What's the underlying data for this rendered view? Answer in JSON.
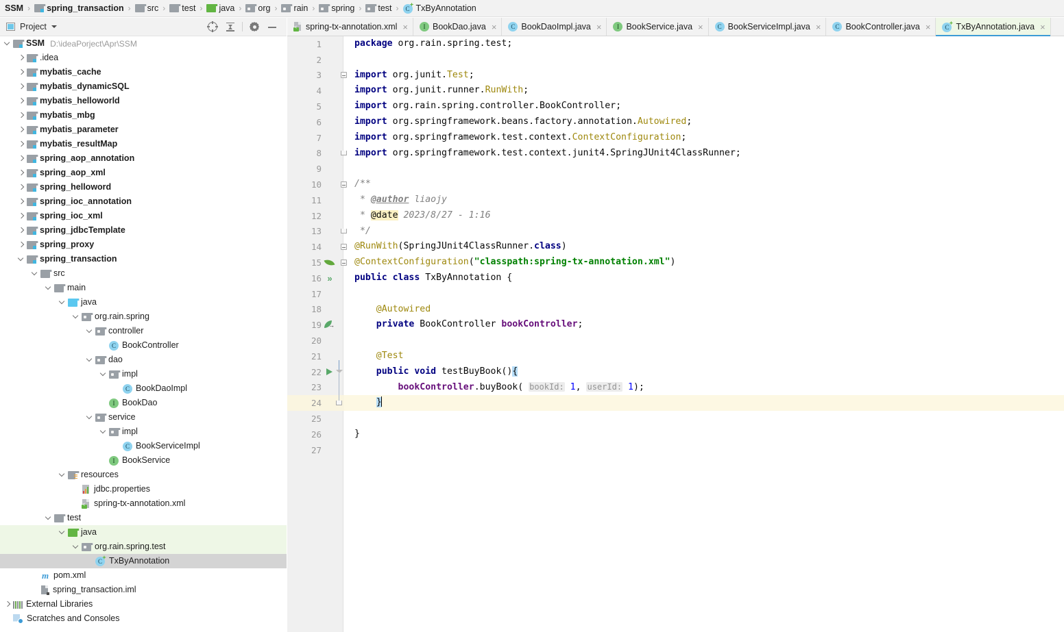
{
  "breadcrumb": {
    "items": [
      {
        "label": "SSM",
        "icon": "none",
        "bold": true
      },
      {
        "label": "spring_transaction",
        "icon": "module-folder-icon",
        "bold": true
      },
      {
        "label": "src",
        "icon": "folder-icon",
        "bold": false
      },
      {
        "label": "test",
        "icon": "folder-icon",
        "bold": false
      },
      {
        "label": "java",
        "icon": "green-folder-icon",
        "bold": false
      },
      {
        "label": "org",
        "icon": "package-icon",
        "bold": false
      },
      {
        "label": "rain",
        "icon": "package-icon",
        "bold": false
      },
      {
        "label": "spring",
        "icon": "package-icon",
        "bold": false
      },
      {
        "label": "test",
        "icon": "package-icon",
        "bold": false
      },
      {
        "label": "TxByAnnotation",
        "icon": "test-class-icon",
        "bold": false
      }
    ],
    "separator": "›"
  },
  "tool_window": {
    "title": "Project",
    "dropdown_icon": "chevron-down-icon",
    "window_icon": "project-window-icon",
    "actions": [
      {
        "name": "locate-icon",
        "tooltip": "Select Opened File"
      },
      {
        "name": "collapse-all-icon",
        "tooltip": "Collapse All"
      },
      {
        "name": "gear-icon",
        "tooltip": "Settings"
      },
      {
        "name": "minimize-icon",
        "tooltip": "Hide"
      }
    ]
  },
  "tree": {
    "rows": [
      {
        "indent": 0,
        "expander": "down",
        "icon": "module-folder-icon",
        "label": "SSM",
        "bold": true,
        "path": "D:\\ideaPorject\\Apr\\SSM",
        "state": "normal"
      },
      {
        "indent": 1,
        "expander": "right",
        "icon": "module-folder-icon",
        "label": ".idea",
        "bold": false,
        "state": "normal"
      },
      {
        "indent": 1,
        "expander": "right",
        "icon": "module-folder-icon",
        "label": "mybatis_cache",
        "bold": true,
        "state": "normal"
      },
      {
        "indent": 1,
        "expander": "right",
        "icon": "module-folder-icon",
        "label": "mybatis_dynamicSQL",
        "bold": true,
        "state": "normal"
      },
      {
        "indent": 1,
        "expander": "right",
        "icon": "module-folder-icon",
        "label": "mybatis_helloworld",
        "bold": true,
        "state": "normal"
      },
      {
        "indent": 1,
        "expander": "right",
        "icon": "module-folder-icon",
        "label": "mybatis_mbg",
        "bold": true,
        "state": "normal"
      },
      {
        "indent": 1,
        "expander": "right",
        "icon": "module-folder-icon",
        "label": "mybatis_parameter",
        "bold": true,
        "state": "normal"
      },
      {
        "indent": 1,
        "expander": "right",
        "icon": "module-folder-icon",
        "label": "mybatis_resultMap",
        "bold": true,
        "state": "normal"
      },
      {
        "indent": 1,
        "expander": "right",
        "icon": "module-folder-icon",
        "label": "spring_aop_annotation",
        "bold": true,
        "state": "normal"
      },
      {
        "indent": 1,
        "expander": "right",
        "icon": "module-folder-icon",
        "label": "spring_aop_xml",
        "bold": true,
        "state": "normal"
      },
      {
        "indent": 1,
        "expander": "right",
        "icon": "module-folder-icon",
        "label": "spring_helloword",
        "bold": true,
        "state": "normal"
      },
      {
        "indent": 1,
        "expander": "right",
        "icon": "module-folder-icon",
        "label": "spring_ioc_annotation",
        "bold": true,
        "state": "normal"
      },
      {
        "indent": 1,
        "expander": "right",
        "icon": "module-folder-icon",
        "label": "spring_ioc_xml",
        "bold": true,
        "state": "normal"
      },
      {
        "indent": 1,
        "expander": "right",
        "icon": "module-folder-icon",
        "label": "spring_jdbcTemplate",
        "bold": true,
        "state": "normal"
      },
      {
        "indent": 1,
        "expander": "right",
        "icon": "module-folder-icon",
        "label": "spring_proxy",
        "bold": true,
        "state": "normal"
      },
      {
        "indent": 1,
        "expander": "down",
        "icon": "module-folder-icon",
        "label": "spring_transaction",
        "bold": true,
        "state": "normal"
      },
      {
        "indent": 2,
        "expander": "down",
        "icon": "folder-icon",
        "label": "src",
        "bold": false,
        "state": "normal"
      },
      {
        "indent": 3,
        "expander": "down",
        "icon": "folder-icon",
        "label": "main",
        "bold": false,
        "state": "normal"
      },
      {
        "indent": 4,
        "expander": "down",
        "icon": "blue-folder-icon",
        "label": "java",
        "bold": false,
        "state": "normal"
      },
      {
        "indent": 5,
        "expander": "down",
        "icon": "package-icon",
        "label": "org.rain.spring",
        "bold": false,
        "state": "normal"
      },
      {
        "indent": 6,
        "expander": "down",
        "icon": "package-icon",
        "label": "controller",
        "bold": false,
        "state": "normal"
      },
      {
        "indent": 7,
        "expander": "none",
        "icon": "class-icon",
        "label": "BookController",
        "bold": false,
        "state": "normal"
      },
      {
        "indent": 6,
        "expander": "down",
        "icon": "package-icon",
        "label": "dao",
        "bold": false,
        "state": "normal"
      },
      {
        "indent": 7,
        "expander": "down",
        "icon": "package-icon",
        "label": "impl",
        "bold": false,
        "state": "normal"
      },
      {
        "indent": 8,
        "expander": "none",
        "icon": "class-icon",
        "label": "BookDaoImpl",
        "bold": false,
        "state": "normal"
      },
      {
        "indent": 7,
        "expander": "none",
        "icon": "interface-icon",
        "label": "BookDao",
        "bold": false,
        "state": "normal"
      },
      {
        "indent": 6,
        "expander": "down",
        "icon": "package-icon",
        "label": "service",
        "bold": false,
        "state": "normal"
      },
      {
        "indent": 7,
        "expander": "down",
        "icon": "package-icon",
        "label": "impl",
        "bold": false,
        "state": "normal"
      },
      {
        "indent": 8,
        "expander": "none",
        "icon": "class-icon",
        "label": "BookServiceImpl",
        "bold": false,
        "state": "normal"
      },
      {
        "indent": 7,
        "expander": "none",
        "icon": "interface-icon",
        "label": "BookService",
        "bold": false,
        "state": "normal"
      },
      {
        "indent": 4,
        "expander": "down",
        "icon": "resources-folder-icon",
        "label": "resources",
        "bold": false,
        "state": "normal"
      },
      {
        "indent": 5,
        "expander": "none",
        "icon": "properties-file-icon",
        "label": "jdbc.properties",
        "bold": false,
        "state": "normal"
      },
      {
        "indent": 5,
        "expander": "none",
        "icon": "xml-file-icon",
        "label": "spring-tx-annotation.xml",
        "bold": false,
        "state": "normal"
      },
      {
        "indent": 3,
        "expander": "down",
        "icon": "folder-icon",
        "label": "test",
        "bold": false,
        "state": "normal"
      },
      {
        "indent": 4,
        "expander": "down",
        "icon": "green-folder-icon",
        "label": "java",
        "bold": false,
        "state": "test-root"
      },
      {
        "indent": 5,
        "expander": "down",
        "icon": "package-icon",
        "label": "org.rain.spring.test",
        "bold": false,
        "state": "test-root"
      },
      {
        "indent": 6,
        "expander": "none",
        "icon": "test-class-icon",
        "label": "TxByAnnotation",
        "bold": false,
        "state": "selected"
      },
      {
        "indent": 2,
        "expander": "none",
        "icon": "maven-icon",
        "label": "pom.xml",
        "bold": false,
        "state": "normal"
      },
      {
        "indent": 2,
        "expander": "none",
        "icon": "iml-file-icon",
        "label": "spring_transaction.iml",
        "bold": false,
        "state": "normal"
      },
      {
        "indent": 0,
        "expander": "right",
        "icon": "external-libraries-icon",
        "label": "External Libraries",
        "bold": false,
        "state": "normal"
      },
      {
        "indent": 0,
        "expander": "none",
        "icon": "scratches-icon",
        "label": "Scratches and Consoles",
        "bold": false,
        "state": "normal"
      }
    ]
  },
  "editor_tabs": {
    "close_glyph": "×",
    "items": [
      {
        "label": "spring-tx-annotation.xml",
        "icon": "xml-file-icon",
        "active": false
      },
      {
        "label": "BookDao.java",
        "icon": "interface-icon",
        "active": false
      },
      {
        "label": "BookDaoImpl.java",
        "icon": "class-icon",
        "active": false
      },
      {
        "label": "BookService.java",
        "icon": "interface-icon",
        "active": false
      },
      {
        "label": "BookServiceImpl.java",
        "icon": "class-icon",
        "active": false
      },
      {
        "label": "BookController.java",
        "icon": "class-icon",
        "active": false
      },
      {
        "label": "TxByAnnotation.java",
        "icon": "test-class-icon",
        "active": true
      }
    ]
  },
  "editor": {
    "filename": "TxByAnnotation.java",
    "caret_line": 24,
    "total_lines": 27,
    "lines": [
      {
        "n": 1,
        "gutter": "none",
        "fold": "none",
        "tokens": [
          {
            "t": "package ",
            "c": "kw"
          },
          {
            "t": "org.rain.spring.test;",
            "c": "plain"
          }
        ]
      },
      {
        "n": 2,
        "gutter": "none",
        "fold": "none",
        "tokens": []
      },
      {
        "n": 3,
        "gutter": "none",
        "fold": "fold-open",
        "tokens": [
          {
            "t": "import ",
            "c": "kw"
          },
          {
            "t": "org.junit.",
            "c": "plain"
          },
          {
            "t": "Test",
            "c": "ann"
          },
          {
            "t": ";",
            "c": "plain"
          }
        ]
      },
      {
        "n": 4,
        "gutter": "none",
        "fold": "none",
        "tokens": [
          {
            "t": "import ",
            "c": "kw"
          },
          {
            "t": "org.junit.runner.",
            "c": "plain"
          },
          {
            "t": "RunWith",
            "c": "ann"
          },
          {
            "t": ";",
            "c": "plain"
          }
        ]
      },
      {
        "n": 5,
        "gutter": "none",
        "fold": "none",
        "tokens": [
          {
            "t": "import ",
            "c": "kw"
          },
          {
            "t": "org.rain.spring.controller.BookController;",
            "c": "plain"
          }
        ]
      },
      {
        "n": 6,
        "gutter": "none",
        "fold": "none",
        "tokens": [
          {
            "t": "import ",
            "c": "kw"
          },
          {
            "t": "org.springframework.beans.factory.annotation.",
            "c": "plain"
          },
          {
            "t": "Autowired",
            "c": "ann"
          },
          {
            "t": ";",
            "c": "plain"
          }
        ]
      },
      {
        "n": 7,
        "gutter": "none",
        "fold": "none",
        "tokens": [
          {
            "t": "import ",
            "c": "kw"
          },
          {
            "t": "org.springframework.test.context.",
            "c": "plain"
          },
          {
            "t": "ContextConfiguration",
            "c": "ann"
          },
          {
            "t": ";",
            "c": "plain"
          }
        ]
      },
      {
        "n": 8,
        "gutter": "none",
        "fold": "fold-end",
        "tokens": [
          {
            "t": "import ",
            "c": "kw"
          },
          {
            "t": "org.springframework.test.context.junit4.SpringJUnit4ClassRunner;",
            "c": "plain"
          }
        ]
      },
      {
        "n": 9,
        "gutter": "none",
        "fold": "none",
        "tokens": []
      },
      {
        "n": 10,
        "gutter": "none",
        "fold": "fold-open",
        "tokens": [
          {
            "t": "/**",
            "c": "cmt"
          }
        ]
      },
      {
        "n": 11,
        "gutter": "none",
        "fold": "none",
        "tokens": [
          {
            "t": " * ",
            "c": "cmt"
          },
          {
            "t": "@author",
            "c": "cmt-tag"
          },
          {
            "t": " liaojy",
            "c": "cmt"
          }
        ]
      },
      {
        "n": 12,
        "gutter": "none",
        "fold": "none",
        "tokens": [
          {
            "t": " * ",
            "c": "cmt"
          },
          {
            "t": "@date",
            "c": "cmt-tag-hl"
          },
          {
            "t": " 2023/8/27 - 1:16",
            "c": "cmt"
          }
        ]
      },
      {
        "n": 13,
        "gutter": "none",
        "fold": "fold-end",
        "tokens": [
          {
            "t": " */",
            "c": "cmt"
          }
        ]
      },
      {
        "n": 14,
        "gutter": "none",
        "fold": "fold-open",
        "tokens": [
          {
            "t": "@RunWith",
            "c": "ann"
          },
          {
            "t": "(SpringJUnit4ClassRunner.",
            "c": "plain"
          },
          {
            "t": "class",
            "c": "kw"
          },
          {
            "t": ")",
            "c": "plain"
          }
        ]
      },
      {
        "n": 15,
        "gutter": "spring-bean-icon",
        "fold": "fold-open",
        "tokens": [
          {
            "t": "@ContextConfiguration",
            "c": "ann"
          },
          {
            "t": "(",
            "c": "plain"
          },
          {
            "t": "\"classpath:spring-tx-annotation.xml\"",
            "c": "str"
          },
          {
            "t": ")",
            "c": "plain"
          }
        ]
      },
      {
        "n": 16,
        "gutter": "run-all-icon",
        "fold": "none",
        "tokens": [
          {
            "t": "public ",
            "c": "kw"
          },
          {
            "t": "class ",
            "c": "kw"
          },
          {
            "t": "TxByAnnotation {",
            "c": "plain"
          }
        ]
      },
      {
        "n": 17,
        "gutter": "none",
        "fold": "none",
        "tokens": []
      },
      {
        "n": 18,
        "gutter": "none",
        "fold": "none",
        "tokens": [
          {
            "t": "    @Autowired",
            "c": "ann"
          }
        ]
      },
      {
        "n": 19,
        "gutter": "navigate-bean-icon",
        "fold": "none",
        "tokens": [
          {
            "t": "    ",
            "c": "plain"
          },
          {
            "t": "private ",
            "c": "kw"
          },
          {
            "t": "BookController ",
            "c": "plain"
          },
          {
            "t": "bookController",
            "c": "fld"
          },
          {
            "t": ";",
            "c": "plain"
          }
        ]
      },
      {
        "n": 20,
        "gutter": "none",
        "fold": "none",
        "tokens": []
      },
      {
        "n": 21,
        "gutter": "none",
        "fold": "none",
        "tokens": [
          {
            "t": "    @Test",
            "c": "ann"
          }
        ]
      },
      {
        "n": 22,
        "gutter": "run-test-icon",
        "fold": "fold-open-method",
        "tokens": [
          {
            "t": "    ",
            "c": "plain"
          },
          {
            "t": "public ",
            "c": "kw"
          },
          {
            "t": "void ",
            "c": "kw"
          },
          {
            "t": "testBuyBook()",
            "c": "plain"
          },
          {
            "t": "{",
            "c": "brace-hl"
          }
        ]
      },
      {
        "n": 23,
        "gutter": "none",
        "fold": "method-line",
        "tokens": [
          {
            "t": "        ",
            "c": "plain"
          },
          {
            "t": "bookController",
            "c": "fld"
          },
          {
            "t": ".buyBook( ",
            "c": "plain"
          },
          {
            "t": "bookId:",
            "c": "hint"
          },
          {
            "t": " ",
            "c": "plain"
          },
          {
            "t": "1",
            "c": "num"
          },
          {
            "t": ", ",
            "c": "plain"
          },
          {
            "t": "userId:",
            "c": "hint"
          },
          {
            "t": " ",
            "c": "plain"
          },
          {
            "t": "1",
            "c": "num"
          },
          {
            "t": ");",
            "c": "plain"
          }
        ]
      },
      {
        "n": 24,
        "gutter": "none",
        "fold": "fold-end-method",
        "caret": true,
        "tokens": [
          {
            "t": "    ",
            "c": "plain"
          },
          {
            "t": "}",
            "c": "brace-hl"
          }
        ]
      },
      {
        "n": 25,
        "gutter": "none",
        "fold": "none",
        "tokens": []
      },
      {
        "n": 26,
        "gutter": "none",
        "fold": "none",
        "tokens": [
          {
            "t": "}",
            "c": "plain"
          }
        ]
      },
      {
        "n": 27,
        "gutter": "none",
        "fold": "none",
        "tokens": []
      }
    ]
  },
  "colors": {
    "accent_blue": "#3c9bd6",
    "test_root_green": "#eef7e6",
    "selection_gray": "#d4d4d4",
    "caret_line": "#fdf8e3",
    "keyword_navy": "#000080",
    "annotation_olive": "#9e880d",
    "string_green": "#008000",
    "field_purple": "#660e7a",
    "comment_gray": "#808080"
  }
}
